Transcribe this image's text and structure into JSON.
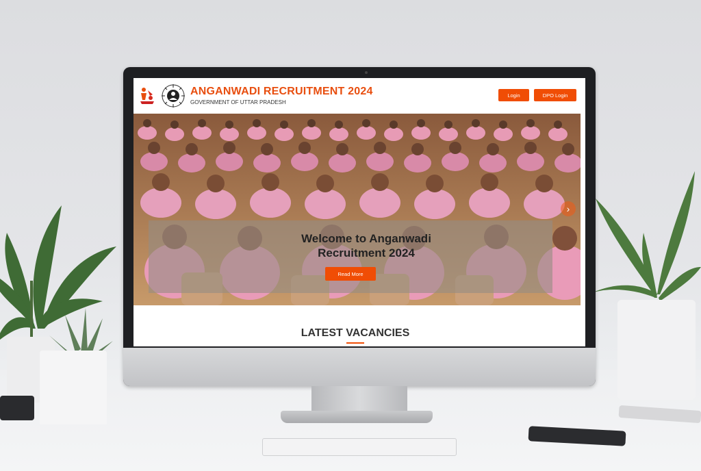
{
  "site": {
    "title": "ANGANWADI RECRUITMENT 2024",
    "subtitle": "GOVERNMENT OF UTTAR PRADESH",
    "login_label": "Login",
    "dpo_login_label": "DPO Login"
  },
  "hero": {
    "heading": "Welcome to Anganwadi Recruitment 2024",
    "button_label": "Read More",
    "next_arrow": "›"
  },
  "section": {
    "title": "LATEST VACANCIES"
  },
  "colors": {
    "accent": "#f04d05",
    "title": "#e84e0f"
  }
}
